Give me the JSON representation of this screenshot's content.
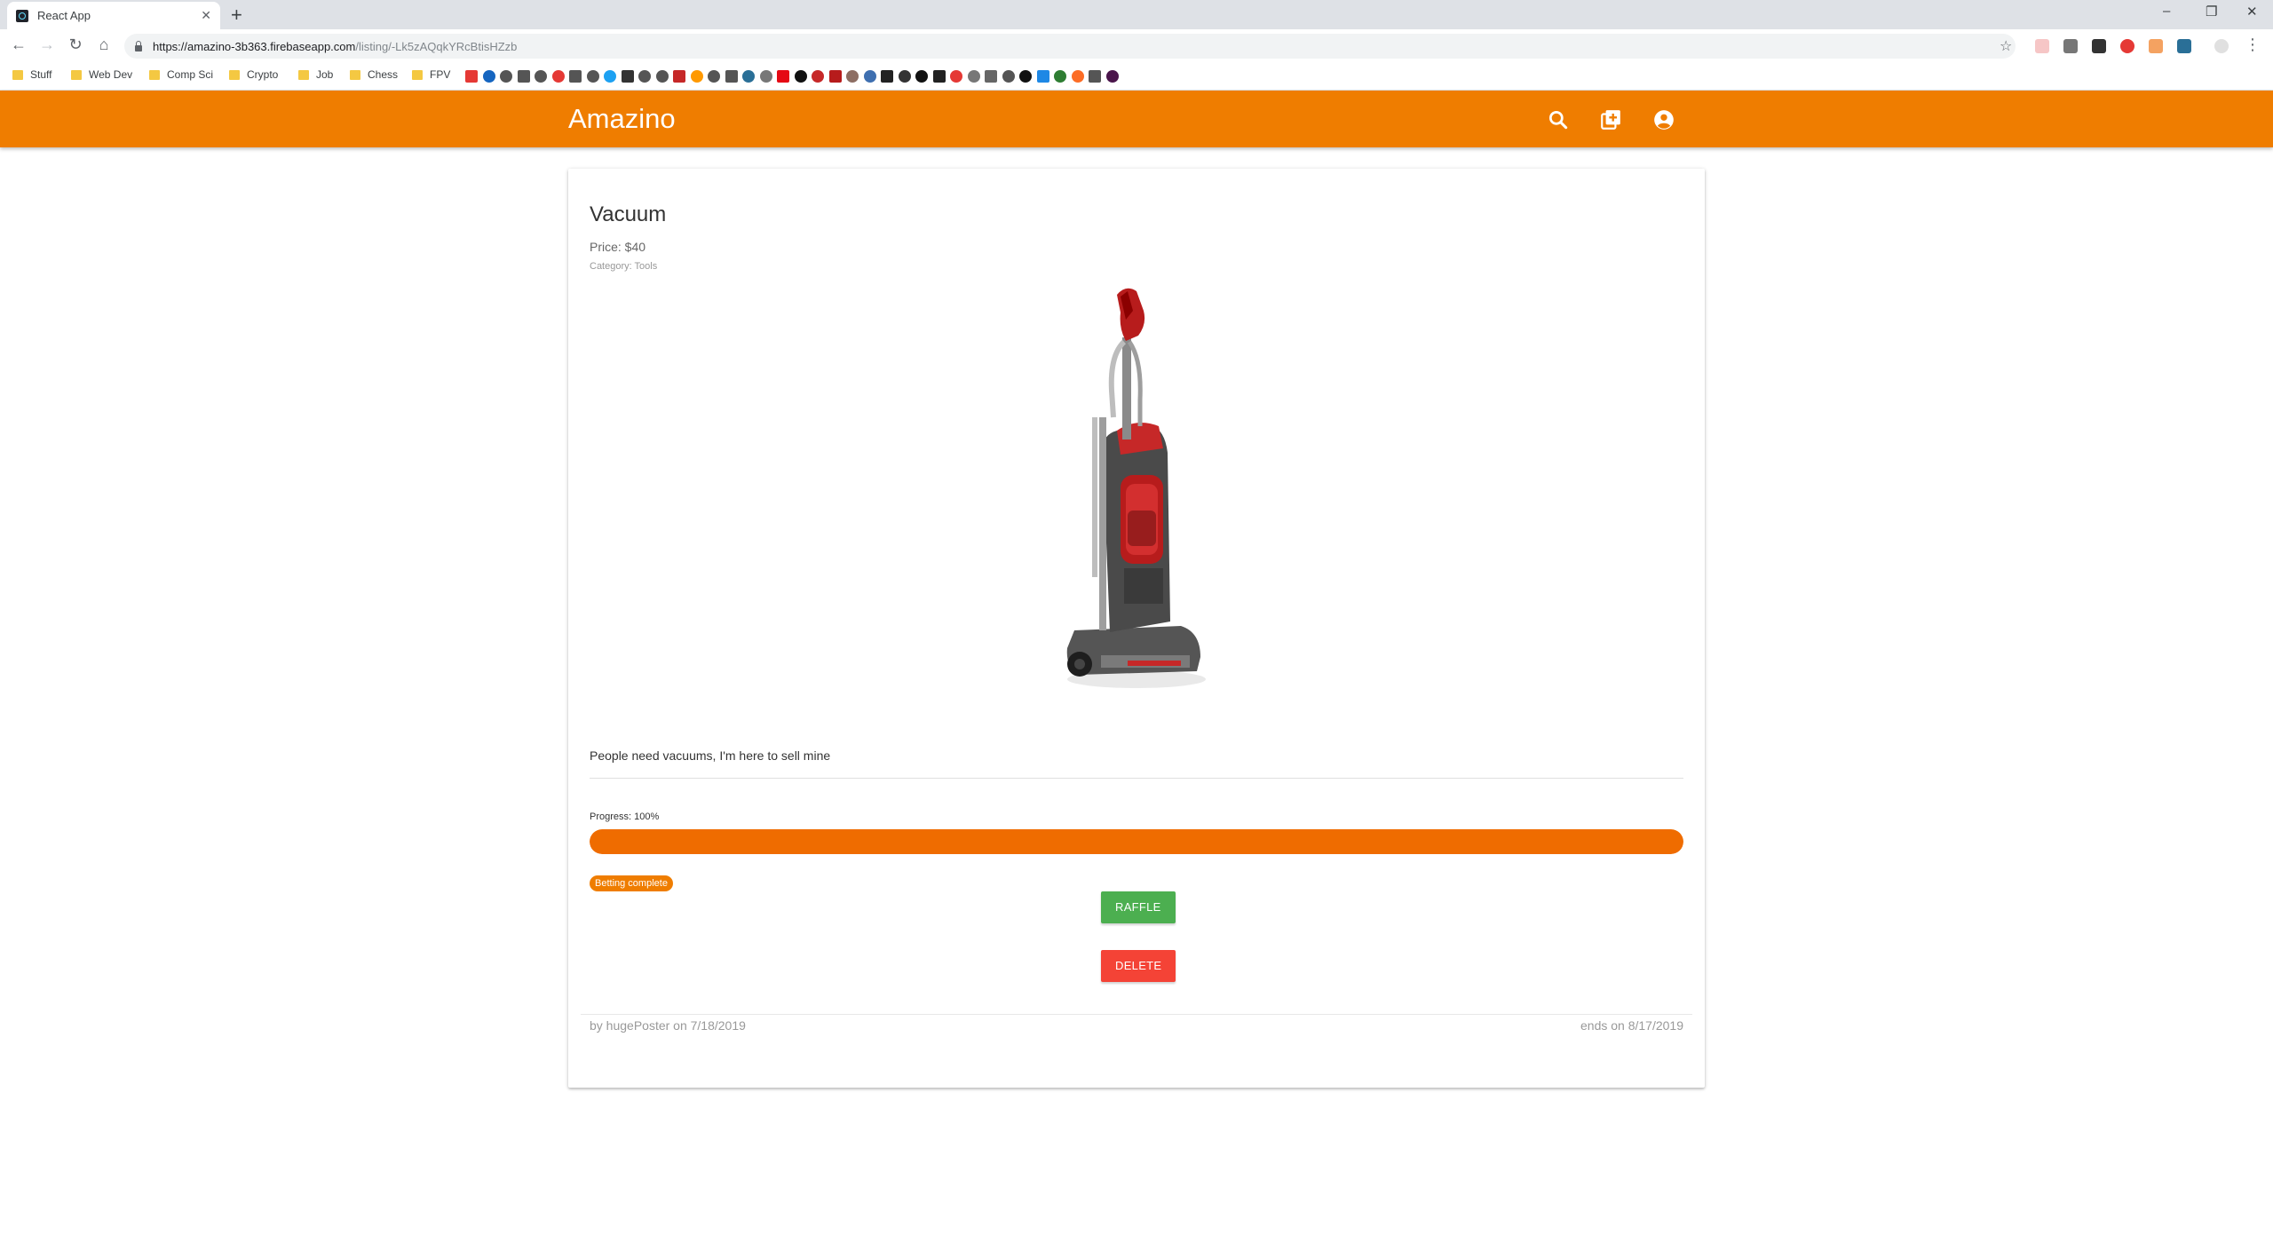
{
  "browser": {
    "tab_title": "React App",
    "tab_close": "✕",
    "new_tab": "+",
    "url_host": "https://amazino-3b363.firebaseapp.com",
    "url_path": "/listing/-Lk5zAQqkYRcBtisHZzb",
    "window_controls": [
      "–",
      "❐",
      "✕"
    ]
  },
  "bookmarks": {
    "folders": [
      "Stuff",
      "Web Dev",
      "Comp Sci",
      "Crypto",
      "Job",
      "Chess",
      "FPV"
    ]
  },
  "app": {
    "brand": "Amazino",
    "accent": "#ef7d00",
    "icons": [
      "search-icon",
      "add-listing-icon",
      "account-icon"
    ]
  },
  "listing": {
    "title": "Vacuum",
    "price": "Price: $40",
    "category": "Category: Tools",
    "description": "People need vacuums, I'm here to sell mine",
    "progress_label": "Progress: 100%",
    "progress_value": 1.0,
    "status_badge": "Betting complete",
    "raffle_label": "RAFFLE",
    "delete_label": "DELETE",
    "byline": "by hugePoster on 7/18/2019",
    "ends": "ends on 8/17/2019"
  }
}
